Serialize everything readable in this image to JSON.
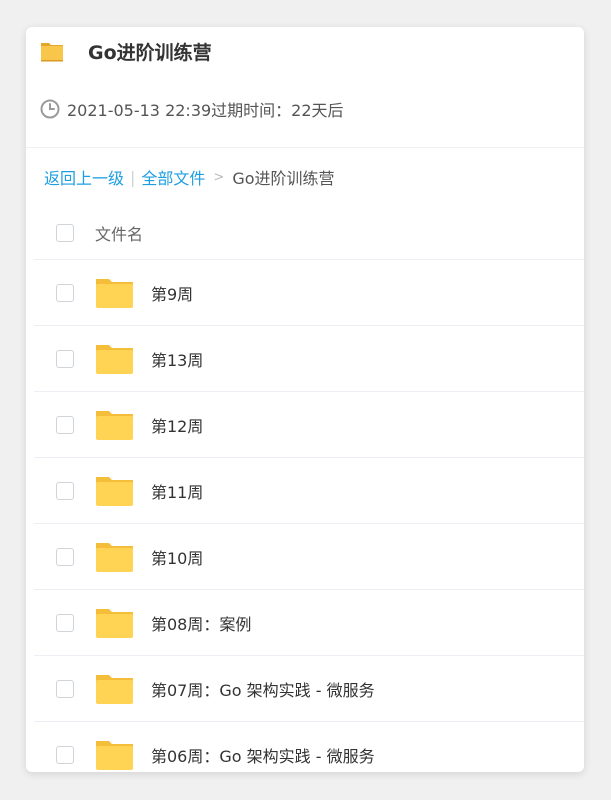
{
  "header": {
    "title": "Go进阶训练营",
    "meta": "2021-05-13 22:39过期时间：22天后"
  },
  "breadcrumb": {
    "back": "返回上一级",
    "all_files": "全部文件",
    "arrow": ">",
    "current": "Go进阶训练营"
  },
  "table": {
    "column_name": "文件名",
    "rows": [
      {
        "name": "第9周"
      },
      {
        "name": "第13周"
      },
      {
        "name": "第12周"
      },
      {
        "name": "第11周"
      },
      {
        "name": "第10周"
      },
      {
        "name": "第08周：案例"
      },
      {
        "name": "第07周：Go 架构实践 - 微服务"
      },
      {
        "name": "第06周：Go 架构实践 - 微服务"
      }
    ]
  },
  "colors": {
    "link": "#1e9ee2",
    "folder": "#ffd455",
    "folder_tab": "#f4be3a"
  },
  "icons": {
    "title": "folder-icon",
    "meta": "clock-icon",
    "row": "folder-icon"
  }
}
